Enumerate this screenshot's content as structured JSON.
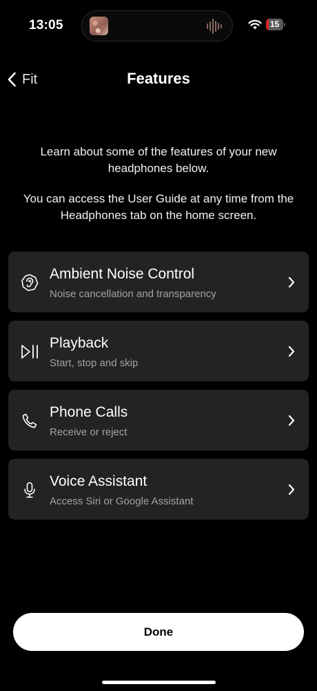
{
  "status_bar": {
    "time": "13:05",
    "battery_level": "15",
    "battery_percent": 15,
    "battery_color": "#e02424",
    "wifi_icon": "wifi-icon"
  },
  "header": {
    "back_label": "Fit",
    "title": "Features"
  },
  "intro": {
    "paragraph1": "Learn about some of the features of your new headphones below.",
    "paragraph2": "You can access the User Guide at any time from the Headphones tab on the home screen."
  },
  "features": [
    {
      "icon": "ear-icon",
      "title": "Ambient Noise Control",
      "subtitle": "Noise cancellation and transparency"
    },
    {
      "icon": "play-pause-icon",
      "title": "Playback",
      "subtitle": "Start, stop and skip"
    },
    {
      "icon": "phone-icon",
      "title": "Phone Calls",
      "subtitle": "Receive or reject"
    },
    {
      "icon": "microphone-icon",
      "title": "Voice Assistant",
      "subtitle": "Access Siri or Google Assistant"
    }
  ],
  "done_label": "Done",
  "colors": {
    "background": "#000000",
    "card": "#232323",
    "subtitle_text": "#a3a3a3",
    "button_bg": "#ffffff"
  }
}
